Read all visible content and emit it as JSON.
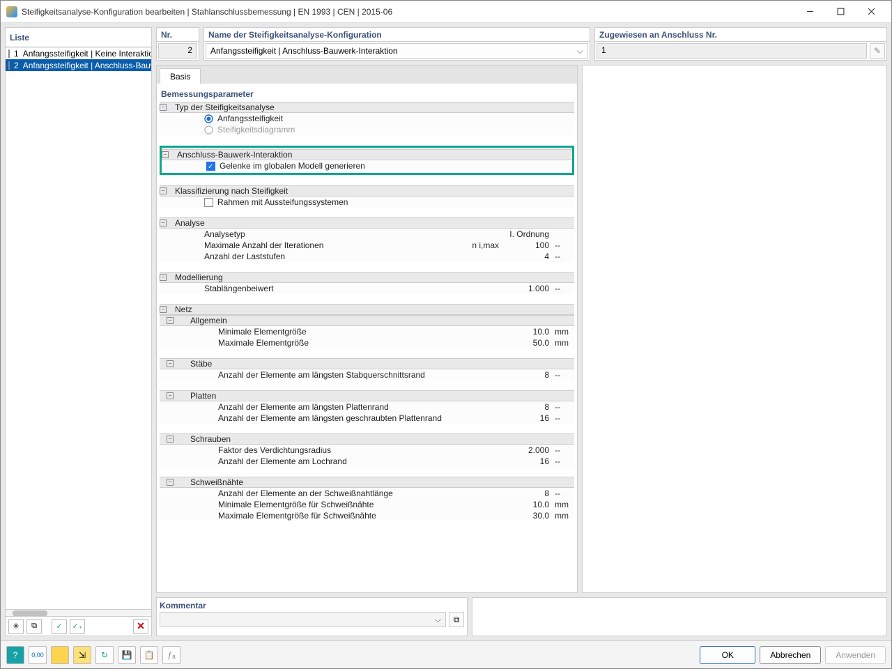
{
  "title": "Steifigkeitsanalyse-Konfiguration bearbeiten | Stahlanschlussbemessung | EN 1993 | CEN | 2015-06",
  "left": {
    "header": "Liste",
    "items": [
      {
        "idx": "1",
        "label": "Anfangssteifigkeit | Keine Interaktion",
        "swatch": "#cfeaf2",
        "selected": false
      },
      {
        "idx": "2",
        "label": "Anfangssteifigkeit | Anschluss-Bauwerk-Interaktion",
        "swatch": "#b7a647",
        "selected": true
      }
    ]
  },
  "top": {
    "nr_label": "Nr.",
    "nr_value": "2",
    "name_label": "Name der Steifigkeitsanalyse-Konfiguration",
    "name_value": "Anfangssteifigkeit | Anschluss-Bauwerk-Interaktion",
    "assigned_label": "Zugewiesen an Anschluss Nr.",
    "assigned_value": "1"
  },
  "tabs": {
    "basis": "Basis"
  },
  "tree": {
    "section": "Bemessungsparameter",
    "type_header": "Typ der Steifigkeitsanalyse",
    "type_opt1": "Anfangssteifigkeit",
    "type_opt2": "Steifigkeitsdiagramm",
    "interaction_header": "Anschluss-Bauwerk-Interaktion",
    "interaction_opt": "Gelenke im globalen Modell generieren",
    "classif_header": "Klassifizierung nach Steifigkeit",
    "classif_opt": "Rahmen mit Aussteifungssystemen",
    "analyse_header": "Analyse",
    "analyse_type_label": "Analysetyp",
    "analyse_type_value": "I. Ordnung",
    "analyse_iter_label": "Maximale Anzahl der Iterationen",
    "analyse_iter_sym": "n i,max",
    "analyse_iter_value": "100",
    "analyse_load_label": "Anzahl der Laststufen",
    "analyse_load_value": "4",
    "model_header": "Modellierung",
    "model_factor_label": "Stablängenbeiwert",
    "model_factor_value": "1.000",
    "mesh_header": "Netz",
    "mesh_general": "Allgemein",
    "mesh_min_label": "Minimale Elementgröße",
    "mesh_min_value": "10.0",
    "mesh_max_label": "Maximale Elementgröße",
    "mesh_max_value": "50.0",
    "members_header": "Stäbe",
    "members_count_label": "Anzahl der Elemente am längsten Stabquerschnittsrand",
    "members_count_value": "8",
    "plates_header": "Platten",
    "plates_edge_label": "Anzahl der Elemente am längsten Plattenrand",
    "plates_edge_value": "8",
    "plates_bolt_label": "Anzahl der Elemente am längsten geschraubten Plattenrand",
    "plates_bolt_value": "16",
    "bolts_header": "Schrauben",
    "bolts_factor_label": "Faktor des Verdichtungsradius",
    "bolts_factor_value": "2.000",
    "bolts_hole_label": "Anzahl der Elemente am Lochrand",
    "bolts_hole_value": "16",
    "welds_header": "Schweißnähte",
    "welds_count_label": "Anzahl der Elemente an der Schweißnahtlänge",
    "welds_count_value": "8",
    "welds_min_label": "Minimale Elementgröße für Schweißnähte",
    "welds_min_value": "10.0",
    "welds_max_label": "Maximale Elementgröße für Schweißnähte",
    "welds_max_value": "30.0",
    "unit_mm": "mm",
    "unit_dash": "--"
  },
  "comment": {
    "header": "Kommentar"
  },
  "buttons": {
    "ok": "OK",
    "cancel": "Abbrechen",
    "apply": "Anwenden"
  }
}
